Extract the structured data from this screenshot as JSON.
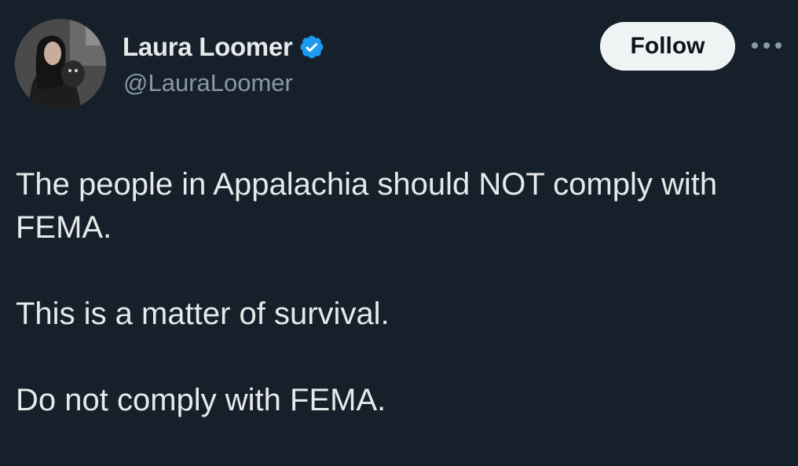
{
  "author": {
    "display_name": "Laura Loomer",
    "handle": "@LauraLoomer",
    "verified_icon": "verified-badge-icon",
    "avatar_icon": "avatar-photo"
  },
  "actions": {
    "follow_label": "Follow",
    "more_icon": "more-options-icon"
  },
  "tweet": {
    "paragraphs": [
      "The people in Appalachia should NOT comply with FEMA.",
      "This is a matter of survival.",
      "Do not comply with FEMA."
    ]
  },
  "colors": {
    "background": "#15202b",
    "text": "#e7e9ea",
    "secondary_text": "#8b98a5",
    "verified_blue": "#1d9bf0",
    "follow_bg": "#eff3f4"
  }
}
